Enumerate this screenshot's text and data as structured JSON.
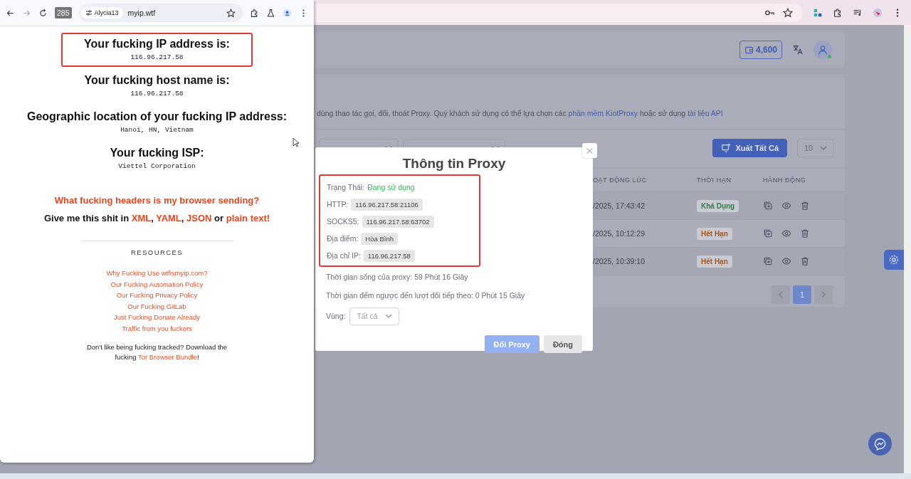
{
  "proxy_page": {
    "balance": "4,600",
    "notice": [
      {
        "text": "dùng thao tác gọi, đổi, thoát Proxy. Quý khách sử dụng có thể lựa chọn các ",
        "kind": "text"
      },
      {
        "text": "phần mềm KiotProxy",
        "kind": "link"
      },
      {
        "text": " hoặc sử dụng ",
        "kind": "text"
      },
      {
        "text": "tài liệu API",
        "kind": "link"
      }
    ],
    "export_button": "Xuất Tất Cả",
    "page_size": "10",
    "columns": [
      "OẠT ĐỘNG LÚC",
      "THỜI HẠN",
      "HÀNH ĐỘNG"
    ],
    "rows": [
      {
        "time": "/2025, 17:43:42",
        "status": "Khả Dụng",
        "color": "#2f7d46"
      },
      {
        "time": "/2025, 10:12:29",
        "status": "Hết Hạn",
        "color": "#a8561a"
      },
      {
        "time": "/2025, 10:39:10",
        "status": "Hết Hạn",
        "color": "#a8561a"
      }
    ],
    "pages": [
      {
        "label": "1",
        "selected": true
      }
    ]
  },
  "modal": {
    "title": "Thông tin Proxy",
    "highlighted": true,
    "status_label": "Trạng Thái:",
    "status": "Đang sử dụng",
    "fields": [
      {
        "label": "HTTP:",
        "value": "116.96.217.58:21106"
      },
      {
        "label": "SOCKS5:",
        "value": "116.96.217.58:63702"
      },
      {
        "label": "Địa điểm:",
        "value": "Hòa Bình"
      },
      {
        "label": "Địa chỉ IP:",
        "value": "116.96.217.58"
      }
    ],
    "lifetime": "Thời gian sống của proxy: 59 Phút 16 Giây",
    "countdown": "Thời gian đếm ngược đến lượt đổi tiếp theo: 0 Phút 15 Giây",
    "region_label": "Vùng:",
    "region": "Tất cả",
    "buttons": [
      {
        "label": "Đổi Proxy",
        "kind": "primary"
      },
      {
        "label": "Đóng",
        "kind": "secondary"
      }
    ]
  },
  "popup": {
    "tab_count": "285",
    "profile_chip": "Alycia13",
    "url": "myip.wtf",
    "sections": [
      {
        "heading": "Your fucking IP address is:",
        "value": "116.96.217.58",
        "highlighted": true
      },
      {
        "heading": "Your fucking host name is:",
        "value": "116.96.217.58",
        "highlighted": false
      },
      {
        "heading": "Geographic location of your fucking IP address:",
        "value": "Hanoi, HN, Vietnam",
        "highlighted": false
      },
      {
        "heading": "Your fucking ISP:",
        "value": "Viettel Corporation",
        "highlighted": false
      }
    ],
    "headers_link": "What fucking headers is my browser sending?",
    "formats": [
      {
        "text": "Give me this shit in ",
        "kind": "text"
      },
      {
        "text": "XML",
        "kind": "link"
      },
      {
        "text": ", ",
        "kind": "text"
      },
      {
        "text": "YAML",
        "kind": "link"
      },
      {
        "text": ", ",
        "kind": "text"
      },
      {
        "text": "JSON",
        "kind": "link"
      },
      {
        "text": " or ",
        "kind": "text"
      },
      {
        "text": "plain text!",
        "kind": "link"
      }
    ],
    "resources_title": "RESOURCES",
    "resources": [
      "Why Fucking Use wtfismyip.com?",
      "Our Fucking Automation Policy",
      "Our Fucking Privacy Policy",
      "Our Fucking GitLab",
      "Just Fucking Donate Already",
      "Traffic from you fuckers"
    ],
    "tor": [
      {
        "text": "Don't like being fucking tracked? Download the fucking ",
        "kind": "text"
      },
      {
        "text": "Tor Browser Bundle",
        "kind": "link"
      },
      {
        "text": "!",
        "kind": "text"
      }
    ]
  }
}
